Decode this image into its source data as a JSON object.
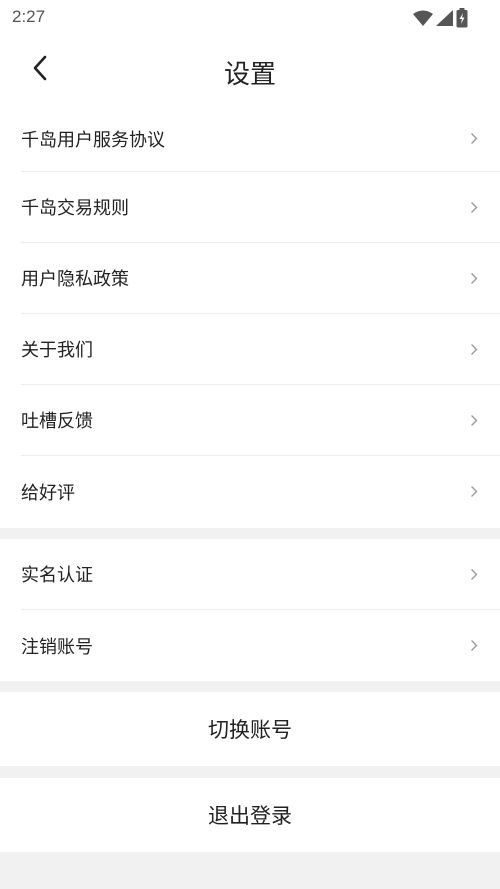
{
  "status_bar": {
    "time": "2:27",
    "icons": [
      "wifi-icon",
      "cellular-signal-icon",
      "battery-icon"
    ]
  },
  "header": {
    "title": "设置",
    "back_icon": "chevron-left-icon"
  },
  "settings_group_1": [
    {
      "label": "千岛用户服务协议"
    },
    {
      "label": "千岛交易规则"
    },
    {
      "label": "用户隐私政策"
    },
    {
      "label": "关于我们"
    },
    {
      "label": "吐槽反馈"
    },
    {
      "label": "给好评"
    }
  ],
  "settings_group_2": [
    {
      "label": "实名认证"
    },
    {
      "label": "注销账号"
    }
  ],
  "actions": {
    "switch_account": "切换账号",
    "logout": "退出登录"
  },
  "colors": {
    "background": "#f1f1f1",
    "surface": "#ffffff",
    "text": "#222222",
    "arrow": "#9a9a9a",
    "divider": "#ececec"
  }
}
